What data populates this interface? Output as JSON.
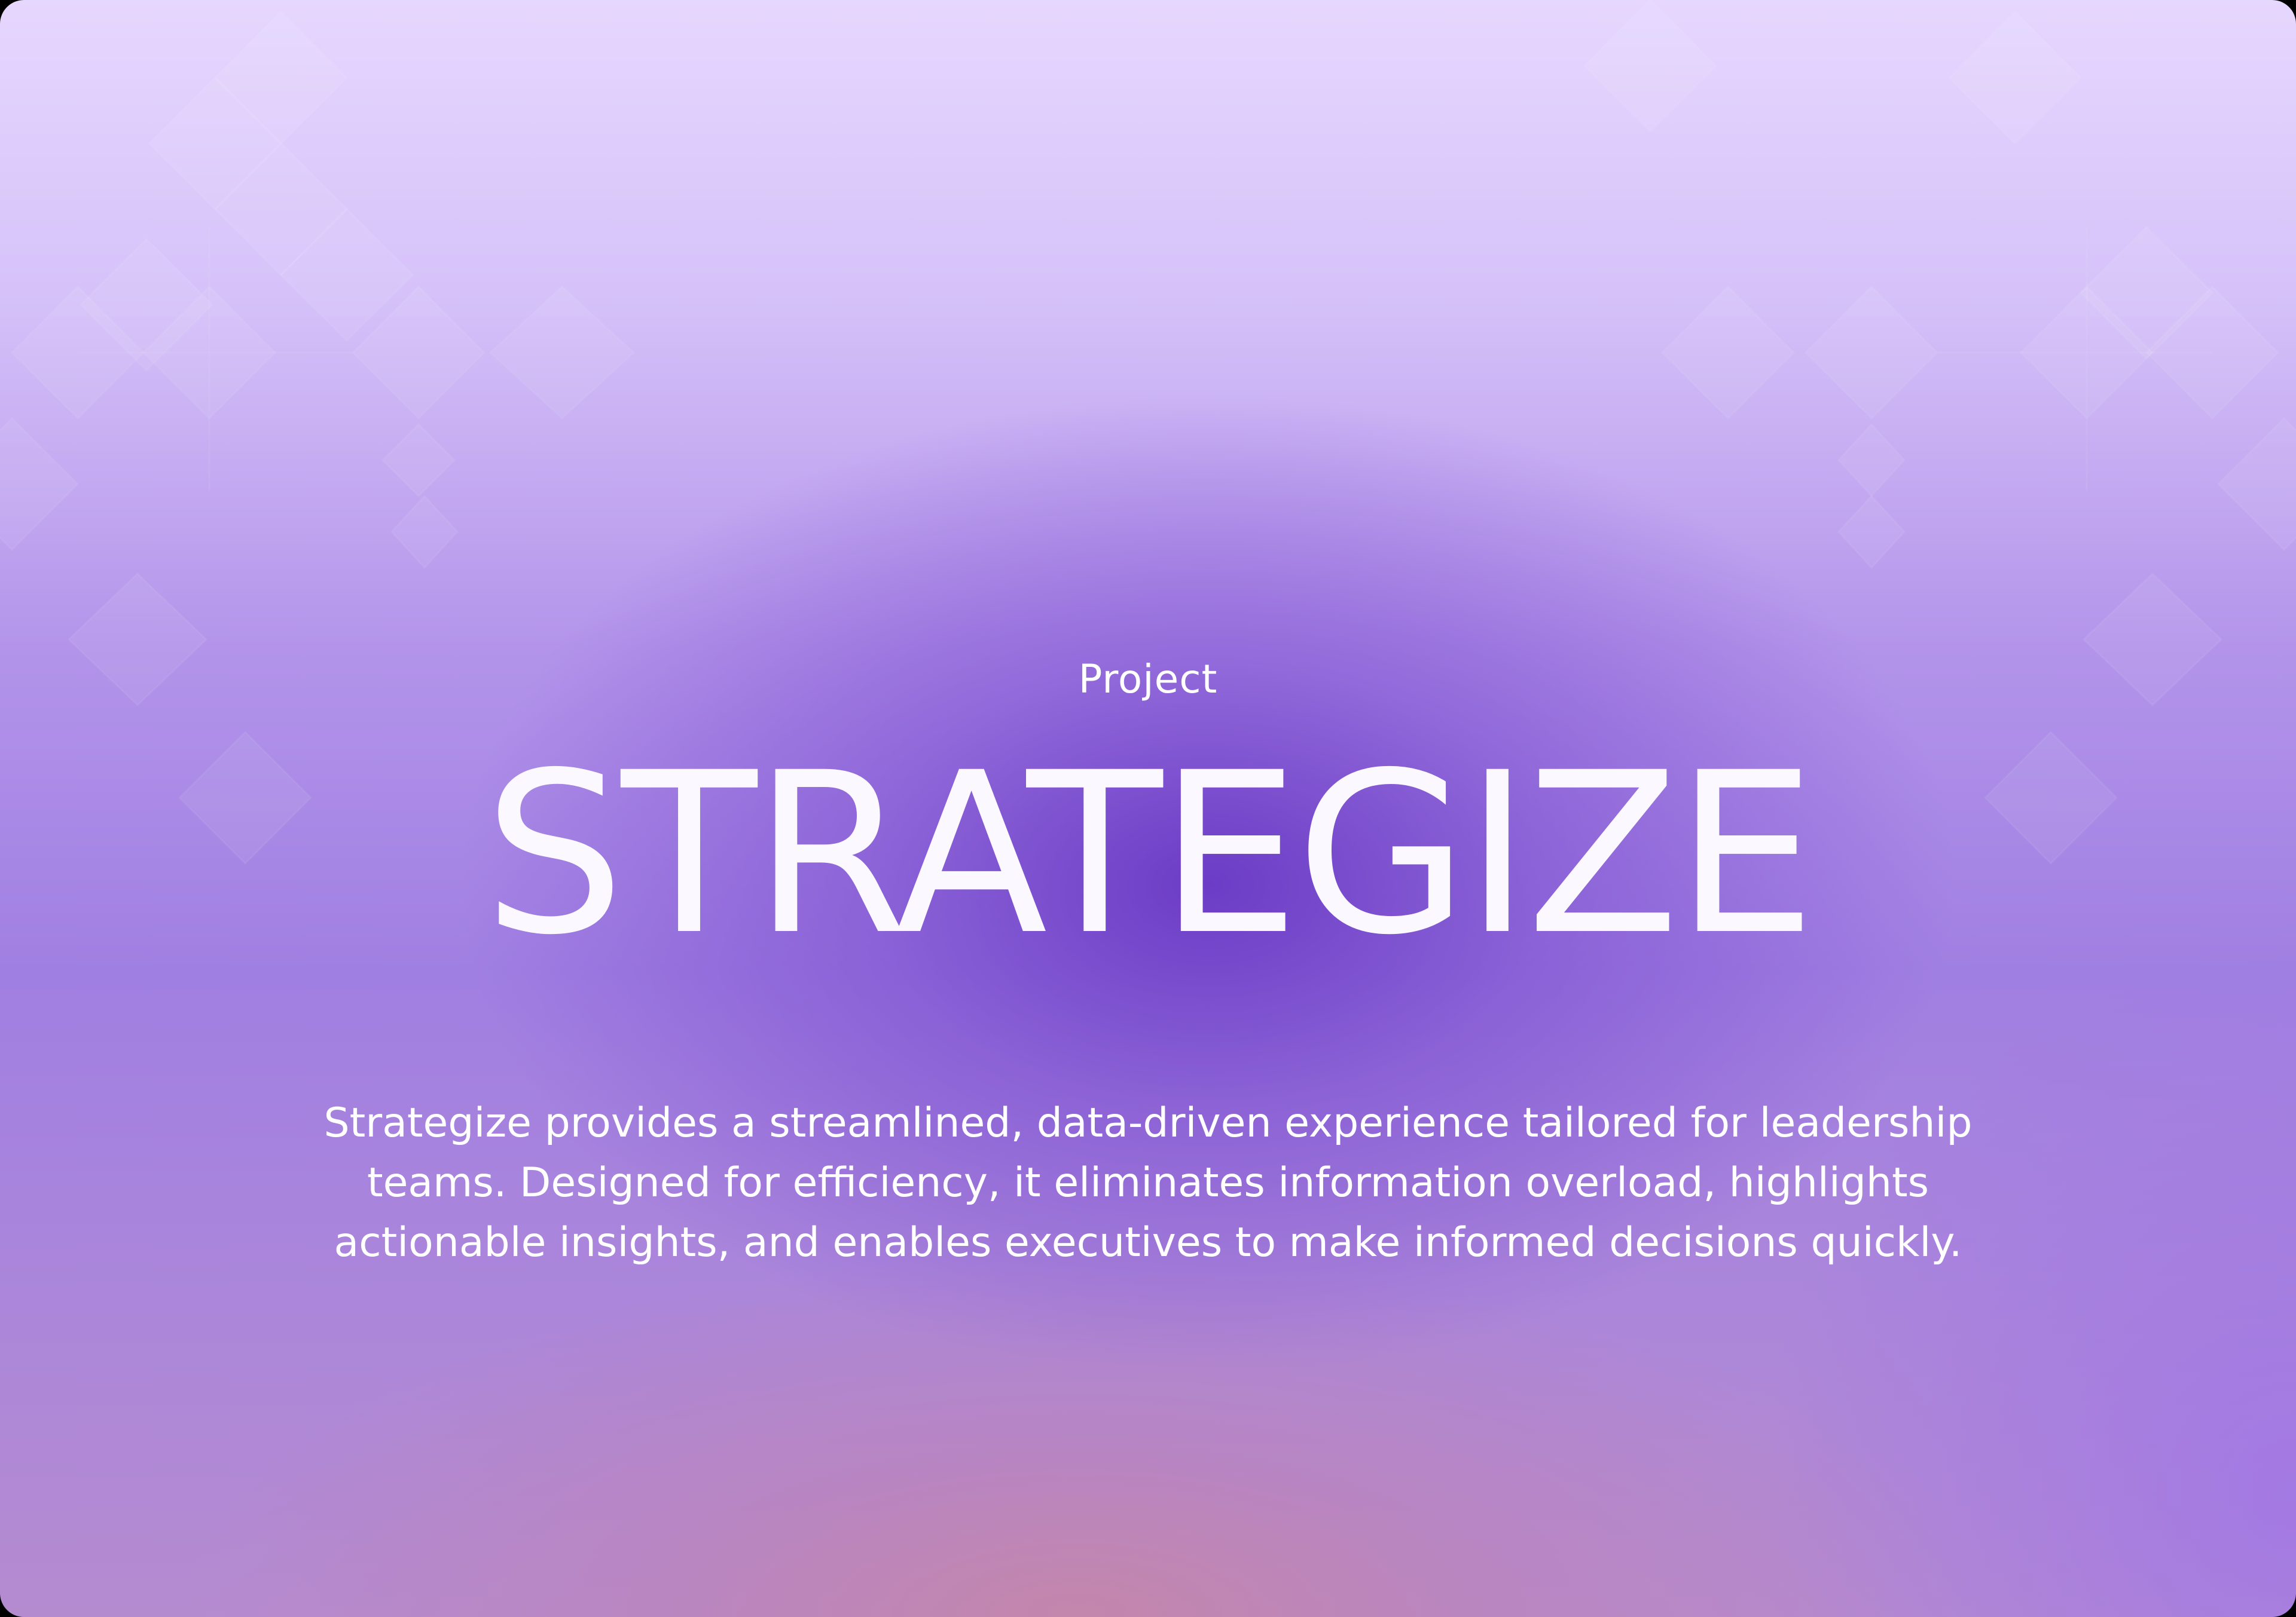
{
  "hero": {
    "eyebrow": "Project",
    "title": "STRATEGIZE",
    "description": "Strategize provides a streamlined, data-driven experience tailored for leadership teams. Designed for efficiency, it eliminates information overload, highlights actionable insights, and enables executives to make informed decisions quickly."
  },
  "colors": {
    "text": "#ffffff",
    "background_top": "#e6d7fe",
    "background_center": "#6838c4",
    "background_bottom": "#c486aa"
  }
}
